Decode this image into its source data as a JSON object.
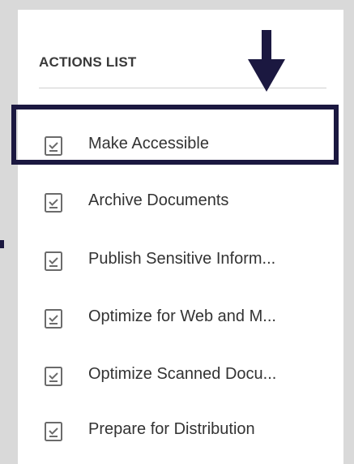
{
  "panel": {
    "title": "ACTIONS LIST"
  },
  "actions": [
    {
      "label": "Make Accessible",
      "icon": "checklist-icon"
    },
    {
      "label": "Archive Documents",
      "icon": "checklist-icon"
    },
    {
      "label": "Publish Sensitive Inform...",
      "icon": "checklist-icon"
    },
    {
      "label": "Optimize for Web and M...",
      "icon": "checklist-icon"
    },
    {
      "label": "Optimize Scanned Docu...",
      "icon": "checklist-icon"
    },
    {
      "label": "Prepare for Distribution",
      "icon": "checklist-icon"
    }
  ],
  "annotation": {
    "highlight_color": "#1b1840",
    "arrow_color": "#1b1840",
    "highlighted_action": "Make Accessible"
  }
}
